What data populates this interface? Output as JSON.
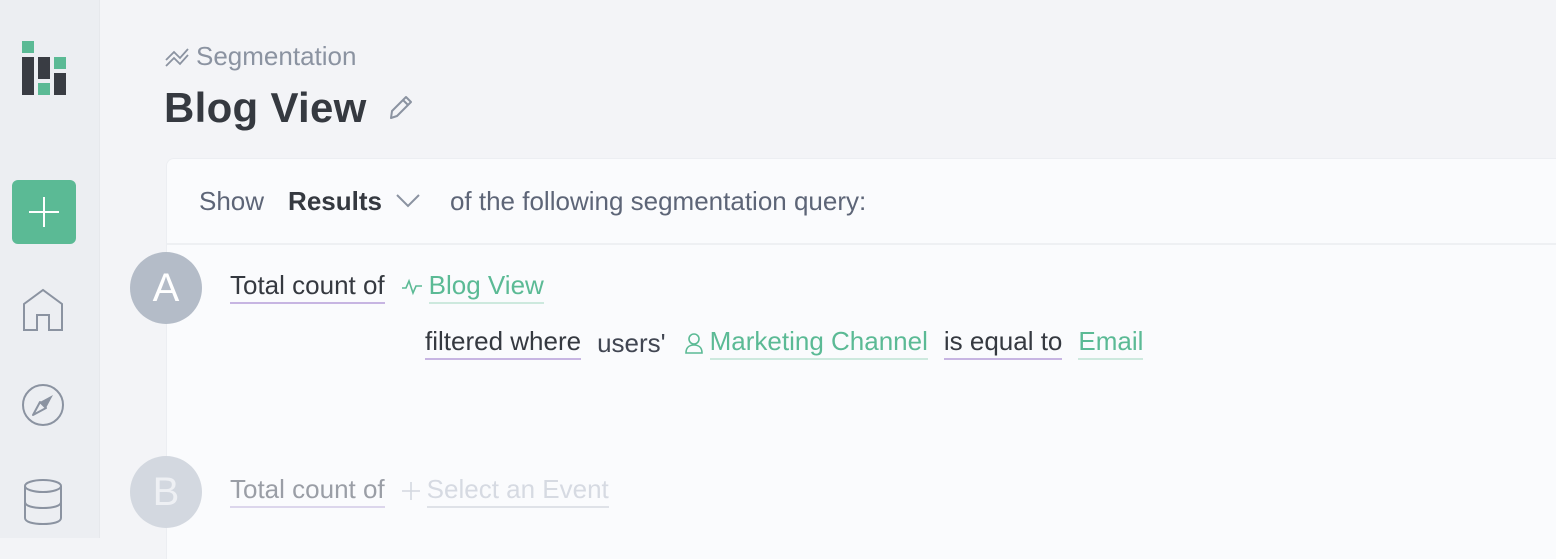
{
  "colors": {
    "accent": "#5bba95",
    "text_dark": "#353940",
    "muted": "#8b93a1",
    "label_a": "#b4bcc8",
    "label_b": "#d3d8e0",
    "underline_purple": "#c7b5e2"
  },
  "sidebar": {
    "logo": "mixpanel-style-bar-logo",
    "new_button": {
      "icon": "plus-icon",
      "label": "Create new"
    },
    "nav": [
      {
        "icon": "home-icon",
        "label": "Home"
      },
      {
        "icon": "compass-icon",
        "label": "Discover"
      },
      {
        "icon": "database-icon",
        "label": "Data"
      }
    ]
  },
  "header": {
    "breadcrumb": "Segmentation",
    "breadcrumb_icon": "segmentation-chart-icon",
    "title": "Blog View",
    "edit_icon": "pencil-icon"
  },
  "query": {
    "show_label": "Show",
    "measure": "Results",
    "measure_icon": "chevron-down-icon",
    "suffix": "of the following segmentation query:",
    "rows": [
      {
        "label": "A",
        "aggregation": "Total count of",
        "event_icon": "event-pulse-icon",
        "event": "Blog View",
        "filter": {
          "prefix": "filtered where",
          "scope": "users'",
          "property_icon": "user-icon",
          "property": "Marketing Channel",
          "operator": "is equal to",
          "value": "Email"
        }
      },
      {
        "label": "B",
        "aggregation": "Total count of",
        "event_icon": "plus-icon",
        "event_placeholder": "Select an Event"
      }
    ]
  }
}
